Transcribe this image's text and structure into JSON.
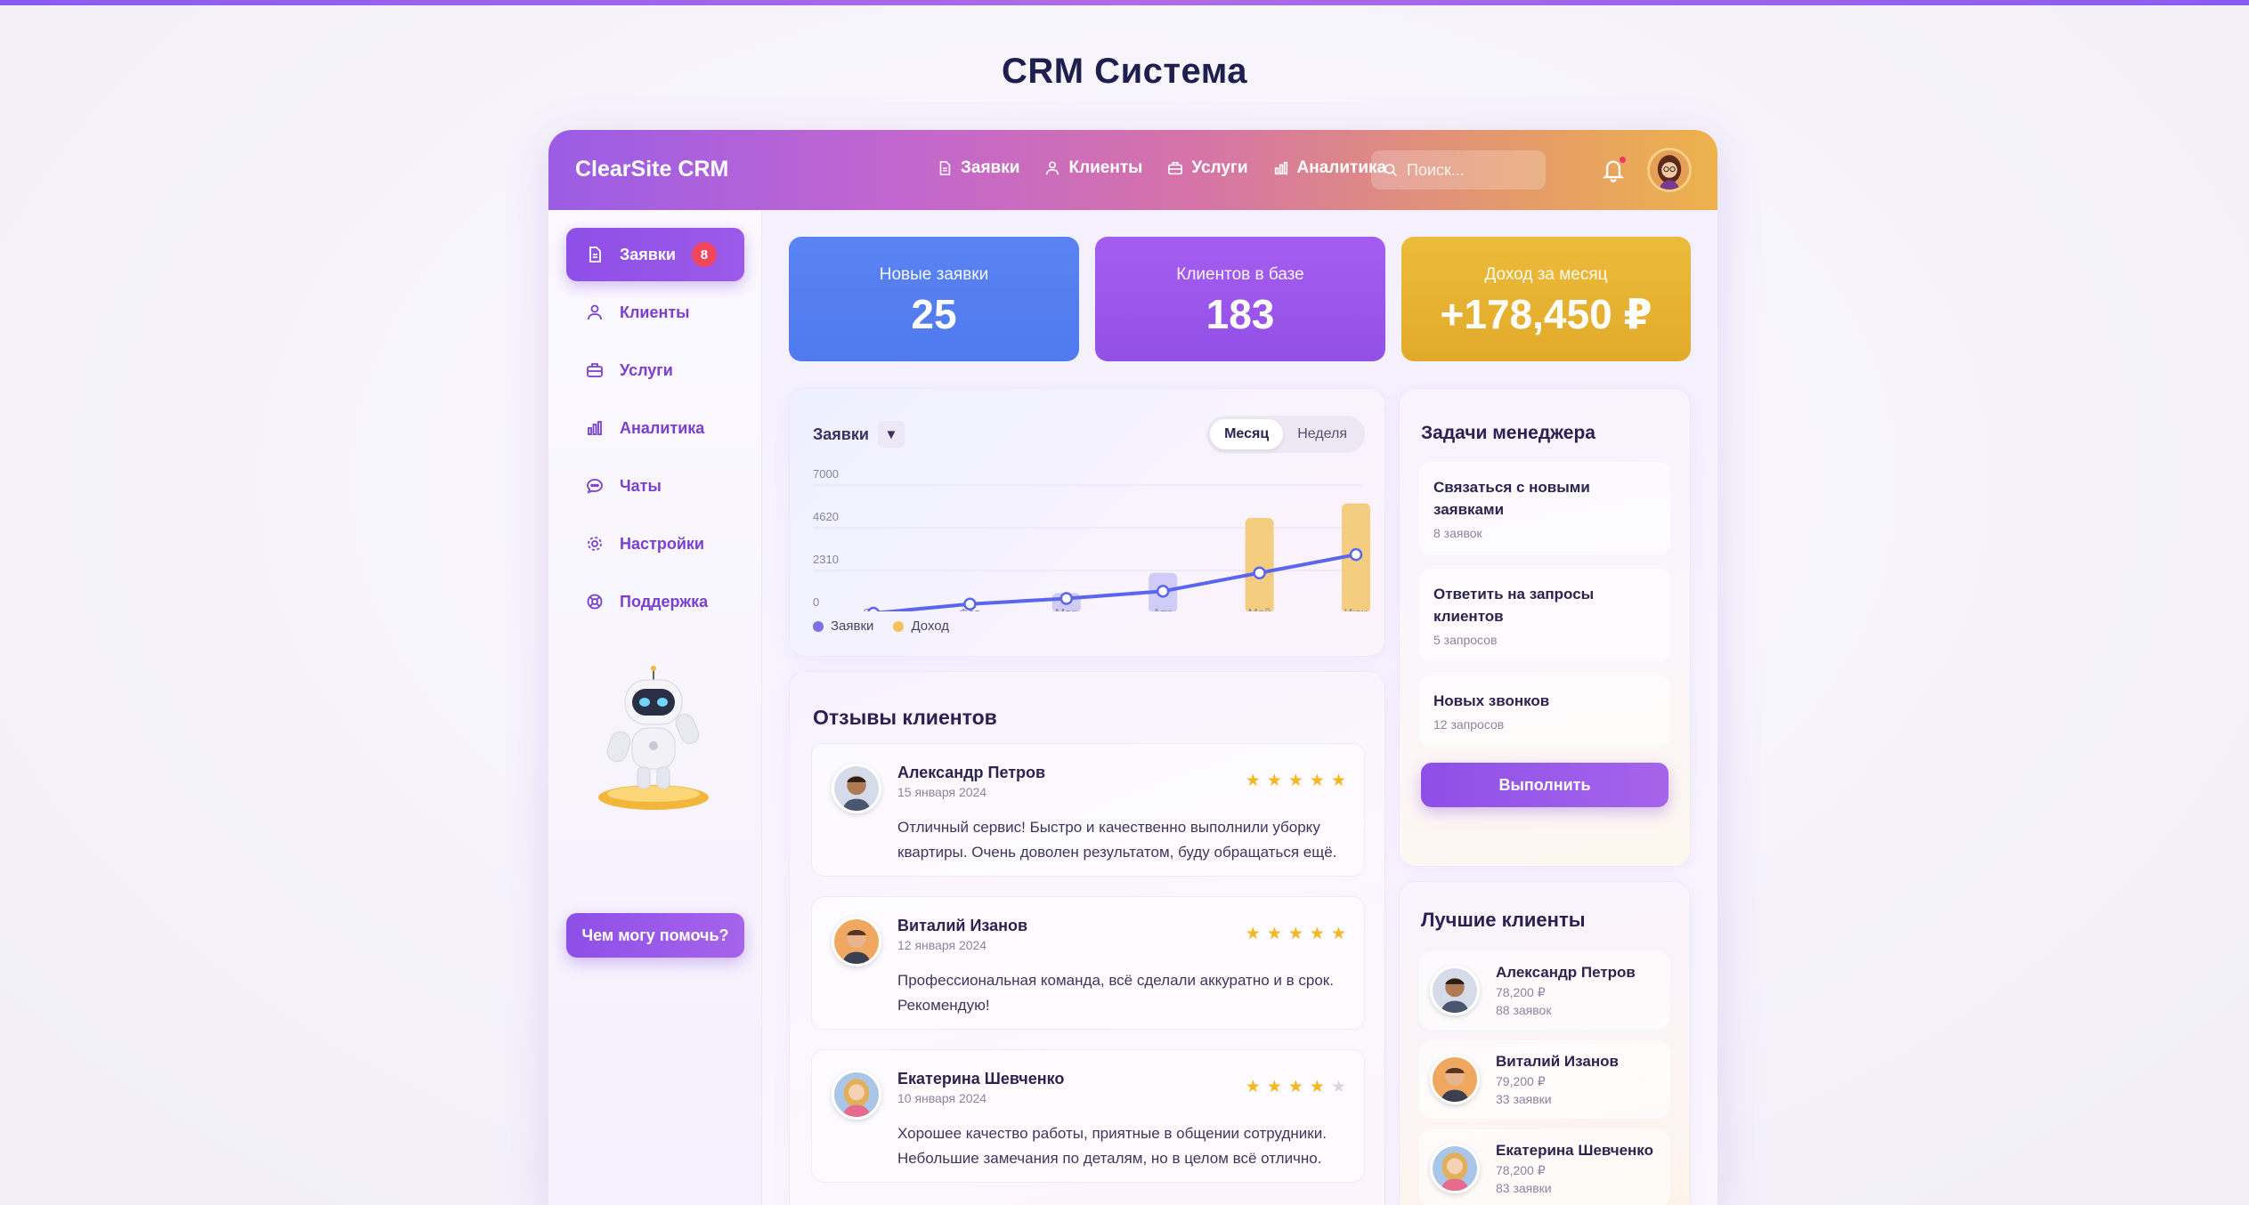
{
  "page_title": "CRM Система",
  "header": {
    "brand": "ClearSite CRM",
    "nav": [
      {
        "label": "Заявки",
        "icon": "document-icon"
      },
      {
        "label": "Клиенты",
        "icon": "users-icon"
      },
      {
        "label": "Услуги",
        "icon": "briefcase-icon"
      },
      {
        "label": "Аналитика",
        "icon": "bar-chart-icon"
      }
    ],
    "search_placeholder": "Поиск...",
    "notification_dot_color": "#ef3b52"
  },
  "sidebar": {
    "items": [
      {
        "label": "Заявки",
        "icon": "document-icon",
        "badge": "8",
        "active": true
      },
      {
        "label": "Клиенты",
        "icon": "users-icon"
      },
      {
        "label": "Услуги",
        "icon": "briefcase-icon"
      },
      {
        "label": "Аналитика",
        "icon": "bar-chart-icon"
      },
      {
        "label": "Чаты",
        "icon": "chat-icon"
      },
      {
        "label": "Настройки",
        "icon": "gear-icon"
      },
      {
        "label": "Поддержка",
        "icon": "lifebuoy-icon"
      }
    ],
    "help_button": "Чем могу помочь?"
  },
  "stats": [
    {
      "label": "Новые заявки",
      "value": "25",
      "color": "#5580f0"
    },
    {
      "label": "Клиентов в базе",
      "value": "183",
      "color": "#9a56ea"
    },
    {
      "label": "Доход за месяц",
      "value": "+178,450 ₽",
      "color": "#e6b232"
    }
  ],
  "chart": {
    "select_label": "Заявки",
    "toggle": [
      "Месяц",
      "Неделя"
    ],
    "toggle_active": "Месяц",
    "legend": [
      {
        "label": "Заявки",
        "color": "#7f6fe6"
      },
      {
        "label": "Доход",
        "color": "#f2c35a"
      }
    ]
  },
  "chart_data": {
    "type": "line",
    "categories": [
      "Янв",
      "Фев",
      "Мар",
      "Апр",
      "Май",
      "Июн"
    ],
    "yticks": [
      "7000",
      "4620",
      "2310",
      "0"
    ],
    "ylim": [
      0,
      7000
    ],
    "grid": true,
    "legend_position": "bottom-left",
    "series": [
      {
        "name": "Заявки",
        "type": "line",
        "color": "#5b66ef",
        "values": [
          0,
          500,
          800,
          1200,
          2200,
          3200
        ]
      },
      {
        "name": "Доход",
        "type": "bar",
        "color": "#f3c66a",
        "values": [
          0,
          0,
          1100,
          2200,
          5200,
          6000
        ]
      }
    ]
  },
  "reviews": {
    "title": "Отзывы клиентов",
    "items": [
      {
        "name": "Александр Петров",
        "date": "15 января 2024",
        "rating": 5,
        "text": "Отличный сервис! Быстро и качественно выполнили уборку квартиры. Очень доволен результатом, буду обращаться ещё."
      },
      {
        "name": "Виталий Изанов",
        "date": "12 января 2024",
        "rating": 5,
        "text": "Профессиональная команда, всё сделали аккуратно и в срок. Рекомендую!"
      },
      {
        "name": "Екатерина Шевченко",
        "date": "10 января 2024",
        "rating": 4,
        "text": "Хорошее качество работы, приятные в общении сотрудники. Небольшие замечания по деталям, но в целом всё отлично."
      }
    ]
  },
  "tasks": {
    "title": "Задачи менеджера",
    "items": [
      {
        "title": "Связаться с новыми заявками",
        "sub": "8 заявок"
      },
      {
        "title": "Ответить на запросы клиентов",
        "sub": "5 запросов"
      },
      {
        "title": "Новых звонков",
        "sub": "12 запросов"
      }
    ],
    "button": "Выполнить"
  },
  "best_clients": {
    "title": "Лучшие клиенты",
    "items": [
      {
        "name": "Александр Петров",
        "amount": "78,200 ₽",
        "orders": "88 заявок"
      },
      {
        "name": "Виталий Изанов",
        "amount": "79,200 ₽",
        "orders": "33 заявки"
      },
      {
        "name": "Екатерина Шевченко",
        "amount": "78,200 ₽",
        "orders": "83 заявки"
      }
    ]
  }
}
